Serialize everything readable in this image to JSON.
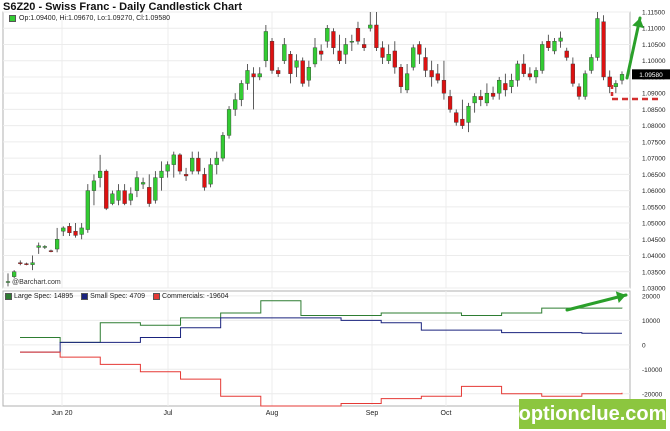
{
  "header": {
    "title": "S6Z20 - Swiss Franc - Daily Candlestick Chart",
    "ohlc_summary": "Op:1.09400, Hi:1.09670, Lo:1.09270, Cl:1.09580"
  },
  "source_label": "@Barchart.com",
  "watermark": "optionclue.com",
  "colors": {
    "up_candle": "#33cc33",
    "down_candle": "#dd1111",
    "large_spec": "#2e7d32",
    "small_spec": "#1a237e",
    "commercials": "#e53935",
    "annotation_arrow": "#2aa02a",
    "level_dash": "#d32f2f",
    "price_tag": "#000000"
  },
  "chart_data": [
    {
      "type": "candlestick",
      "title": "S6Z20 - Swiss Franc - Daily Candlestick Chart",
      "x_tick_labels": [
        "Jun 20",
        "Jul",
        "Aug",
        "Sep",
        "Oct"
      ],
      "ylim": [
        1.03,
        1.115
      ],
      "y_ticks": [
        1.115,
        1.11,
        1.105,
        1.1,
        1.095,
        1.09,
        1.085,
        1.08,
        1.075,
        1.07,
        1.065,
        1.06,
        1.055,
        1.05,
        1.045,
        1.04,
        1.035,
        1.03
      ],
      "y_tick_labels": [
        "1.11500",
        "1.11000",
        "1.10500",
        "1.10000",
        "1.09500",
        "1.09000",
        "1.08500",
        "1.08000",
        "1.07500",
        "1.07000",
        "1.06500",
        "1.06000",
        "1.05500",
        "1.05000",
        "1.04500",
        "1.04000",
        "1.03500",
        "1.03000"
      ],
      "last_price_label": "1.09580",
      "last_price": 1.0958,
      "grid": true,
      "candles": [
        {
          "o": 1.0318,
          "h": 1.0345,
          "l": 1.0305,
          "c": 1.032
        },
        {
          "o": 1.0335,
          "h": 1.0355,
          "l": 1.033,
          "c": 1.035
        },
        {
          "o": 1.0378,
          "h": 1.0385,
          "l": 1.037,
          "c": 1.0376
        },
        {
          "o": 1.0375,
          "h": 1.0378,
          "l": 1.037,
          "c": 1.0372
        },
        {
          "o": 1.0372,
          "h": 1.04,
          "l": 1.0355,
          "c": 1.0378
        },
        {
          "o": 1.0425,
          "h": 1.044,
          "l": 1.0405,
          "c": 1.043
        },
        {
          "o": 1.0426,
          "h": 1.0432,
          "l": 1.042,
          "c": 1.0428
        },
        {
          "o": 1.0415,
          "h": 1.0418,
          "l": 1.041,
          "c": 1.0412
        },
        {
          "o": 1.042,
          "h": 1.0485,
          "l": 1.041,
          "c": 1.045
        },
        {
          "o": 1.0475,
          "h": 1.049,
          "l": 1.046,
          "c": 1.0485
        },
        {
          "o": 1.049,
          "h": 1.05,
          "l": 1.046,
          "c": 1.047
        },
        {
          "o": 1.0475,
          "h": 1.05,
          "l": 1.0455,
          "c": 1.0462
        },
        {
          "o": 1.0465,
          "h": 1.05,
          "l": 1.045,
          "c": 1.0485
        },
        {
          "o": 1.048,
          "h": 1.062,
          "l": 1.047,
          "c": 1.06
        },
        {
          "o": 1.06,
          "h": 1.065,
          "l": 1.0555,
          "c": 1.063
        },
        {
          "o": 1.064,
          "h": 1.071,
          "l": 1.061,
          "c": 1.066
        },
        {
          "o": 1.066,
          "h": 1.0665,
          "l": 1.054,
          "c": 1.0545
        },
        {
          "o": 1.056,
          "h": 1.06,
          "l": 1.0555,
          "c": 1.059
        },
        {
          "o": 1.057,
          "h": 1.062,
          "l": 1.0555,
          "c": 1.06
        },
        {
          "o": 1.06,
          "h": 1.062,
          "l": 1.0555,
          "c": 1.056
        },
        {
          "o": 1.057,
          "h": 1.061,
          "l": 1.0555,
          "c": 1.059
        },
        {
          "o": 1.06,
          "h": 1.066,
          "l": 1.058,
          "c": 1.064
        },
        {
          "o": 1.062,
          "h": 1.064,
          "l": 1.0605,
          "c": 1.0625
        },
        {
          "o": 1.061,
          "h": 1.065,
          "l": 1.055,
          "c": 1.056
        },
        {
          "o": 1.057,
          "h": 1.066,
          "l": 1.056,
          "c": 1.064
        },
        {
          "o": 1.064,
          "h": 1.069,
          "l": 1.06,
          "c": 1.066
        },
        {
          "o": 1.066,
          "h": 1.069,
          "l": 1.064,
          "c": 1.068
        },
        {
          "o": 1.068,
          "h": 1.072,
          "l": 1.064,
          "c": 1.071
        },
        {
          "o": 1.071,
          "h": 1.0715,
          "l": 1.065,
          "c": 1.066
        },
        {
          "o": 1.065,
          "h": 1.067,
          "l": 1.063,
          "c": 1.0645
        },
        {
          "o": 1.066,
          "h": 1.072,
          "l": 1.065,
          "c": 1.07
        },
        {
          "o": 1.07,
          "h": 1.072,
          "l": 1.065,
          "c": 1.066
        },
        {
          "o": 1.065,
          "h": 1.067,
          "l": 1.06,
          "c": 1.061
        },
        {
          "o": 1.062,
          "h": 1.07,
          "l": 1.061,
          "c": 1.068
        },
        {
          "o": 1.068,
          "h": 1.072,
          "l": 1.065,
          "c": 1.07
        },
        {
          "o": 1.07,
          "h": 1.078,
          "l": 1.069,
          "c": 1.077
        },
        {
          "o": 1.077,
          "h": 1.086,
          "l": 1.076,
          "c": 1.085
        },
        {
          "o": 1.085,
          "h": 1.09,
          "l": 1.083,
          "c": 1.088
        },
        {
          "o": 1.088,
          "h": 1.094,
          "l": 1.086,
          "c": 1.093
        },
        {
          "o": 1.093,
          "h": 1.099,
          "l": 1.091,
          "c": 1.097
        },
        {
          "o": 1.096,
          "h": 1.098,
          "l": 1.085,
          "c": 1.095
        },
        {
          "o": 1.095,
          "h": 1.098,
          "l": 1.094,
          "c": 1.096
        },
        {
          "o": 1.1,
          "h": 1.111,
          "l": 1.098,
          "c": 1.109
        },
        {
          "o": 1.106,
          "h": 1.107,
          "l": 1.096,
          "c": 1.097
        },
        {
          "o": 1.097,
          "h": 1.098,
          "l": 1.095,
          "c": 1.096
        },
        {
          "o": 1.1,
          "h": 1.107,
          "l": 1.099,
          "c": 1.105
        },
        {
          "o": 1.102,
          "h": 1.103,
          "l": 1.093,
          "c": 1.096
        },
        {
          "o": 1.098,
          "h": 1.102,
          "l": 1.095,
          "c": 1.1
        },
        {
          "o": 1.1,
          "h": 1.101,
          "l": 1.092,
          "c": 1.093
        },
        {
          "o": 1.094,
          "h": 1.1,
          "l": 1.092,
          "c": 1.098
        },
        {
          "o": 1.099,
          "h": 1.107,
          "l": 1.098,
          "c": 1.104
        },
        {
          "o": 1.103,
          "h": 1.105,
          "l": 1.1,
          "c": 1.102
        },
        {
          "o": 1.106,
          "h": 1.111,
          "l": 1.104,
          "c": 1.11
        },
        {
          "o": 1.109,
          "h": 1.11,
          "l": 1.102,
          "c": 1.104
        },
        {
          "o": 1.103,
          "h": 1.108,
          "l": 1.099,
          "c": 1.1
        },
        {
          "o": 1.102,
          "h": 1.107,
          "l": 1.099,
          "c": 1.105
        },
        {
          "o": 1.106,
          "h": 1.108,
          "l": 1.103,
          "c": 1.106
        },
        {
          "o": 1.11,
          "h": 1.112,
          "l": 1.105,
          "c": 1.106
        },
        {
          "o": 1.105,
          "h": 1.107,
          "l": 1.103,
          "c": 1.104
        },
        {
          "o": 1.11,
          "h": 1.115,
          "l": 1.109,
          "c": 1.111
        },
        {
          "o": 1.111,
          "h": 1.115,
          "l": 1.103,
          "c": 1.104
        },
        {
          "o": 1.104,
          "h": 1.106,
          "l": 1.099,
          "c": 1.101
        },
        {
          "o": 1.1,
          "h": 1.105,
          "l": 1.099,
          "c": 1.102
        },
        {
          "o": 1.103,
          "h": 1.106,
          "l": 1.096,
          "c": 1.098
        },
        {
          "o": 1.098,
          "h": 1.099,
          "l": 1.09,
          "c": 1.092
        },
        {
          "o": 1.091,
          "h": 1.099,
          "l": 1.09,
          "c": 1.096
        },
        {
          "o": 1.098,
          "h": 1.105,
          "l": 1.097,
          "c": 1.104
        },
        {
          "o": 1.105,
          "h": 1.106,
          "l": 1.099,
          "c": 1.102
        },
        {
          "o": 1.101,
          "h": 1.104,
          "l": 1.095,
          "c": 1.097
        },
        {
          "o": 1.097,
          "h": 1.1,
          "l": 1.092,
          "c": 1.095
        },
        {
          "o": 1.096,
          "h": 1.099,
          "l": 1.093,
          "c": 1.094
        },
        {
          "o": 1.094,
          "h": 1.1,
          "l": 1.088,
          "c": 1.09
        },
        {
          "o": 1.089,
          "h": 1.091,
          "l": 1.084,
          "c": 1.085
        },
        {
          "o": 1.084,
          "h": 1.085,
          "l": 1.08,
          "c": 1.081
        },
        {
          "o": 1.082,
          "h": 1.088,
          "l": 1.079,
          "c": 1.08
        },
        {
          "o": 1.081,
          "h": 1.087,
          "l": 1.078,
          "c": 1.086
        },
        {
          "o": 1.087,
          "h": 1.09,
          "l": 1.084,
          "c": 1.089
        },
        {
          "o": 1.089,
          "h": 1.091,
          "l": 1.086,
          "c": 1.088
        },
        {
          "o": 1.087,
          "h": 1.093,
          "l": 1.086,
          "c": 1.09
        },
        {
          "o": 1.09,
          "h": 1.092,
          "l": 1.088,
          "c": 1.089
        },
        {
          "o": 1.09,
          "h": 1.095,
          "l": 1.088,
          "c": 1.094
        },
        {
          "o": 1.093,
          "h": 1.096,
          "l": 1.089,
          "c": 1.091
        },
        {
          "o": 1.092,
          "h": 1.096,
          "l": 1.09,
          "c": 1.094
        },
        {
          "o": 1.094,
          "h": 1.1,
          "l": 1.092,
          "c": 1.099
        },
        {
          "o": 1.099,
          "h": 1.102,
          "l": 1.095,
          "c": 1.096
        },
        {
          "o": 1.096,
          "h": 1.098,
          "l": 1.094,
          "c": 1.095
        },
        {
          "o": 1.095,
          "h": 1.098,
          "l": 1.093,
          "c": 1.097
        },
        {
          "o": 1.097,
          "h": 1.106,
          "l": 1.096,
          "c": 1.105
        },
        {
          "o": 1.106,
          "h": 1.108,
          "l": 1.103,
          "c": 1.104
        },
        {
          "o": 1.103,
          "h": 1.107,
          "l": 1.102,
          "c": 1.106
        },
        {
          "o": 1.106,
          "h": 1.109,
          "l": 1.104,
          "c": 1.107
        },
        {
          "o": 1.103,
          "h": 1.104,
          "l": 1.1,
          "c": 1.101
        },
        {
          "o": 1.099,
          "h": 1.101,
          "l": 1.092,
          "c": 1.093
        },
        {
          "o": 1.092,
          "h": 1.093,
          "l": 1.088,
          "c": 1.089
        },
        {
          "o": 1.089,
          "h": 1.097,
          "l": 1.088,
          "c": 1.096
        },
        {
          "o": 1.097,
          "h": 1.102,
          "l": 1.096,
          "c": 1.101
        },
        {
          "o": 1.101,
          "h": 1.115,
          "l": 1.1,
          "c": 1.113
        },
        {
          "o": 1.112,
          "h": 1.114,
          "l": 1.094,
          "c": 1.095
        },
        {
          "o": 1.095,
          "h": 1.097,
          "l": 1.09,
          "c": 1.092
        },
        {
          "o": 1.092,
          "h": 1.094,
          "l": 1.09,
          "c": 1.093
        },
        {
          "o": 1.094,
          "h": 1.0967,
          "l": 1.0927,
          "c": 1.0958
        }
      ]
    },
    {
      "type": "line",
      "title": "",
      "ylim": [
        -25000,
        22000
      ],
      "y_ticks": [
        20000,
        10000,
        0,
        -10000,
        -20000
      ],
      "y_tick_labels": [
        "20000",
        "10000",
        "0",
        "-10000",
        "-20000"
      ],
      "step": true,
      "series": [
        {
          "name": "Large Spec",
          "legend": "Large Spec: 14895",
          "color_key": "large_spec",
          "values": [
            3000,
            1000,
            9000,
            8000,
            11000,
            13000,
            18000,
            12000,
            12000,
            13000,
            13000,
            12000,
            13000,
            15000,
            15000,
            14895
          ]
        },
        {
          "name": "Small Spec",
          "legend": "Small Spec: 4709",
          "color_key": "small_spec",
          "values": [
            -3000,
            1000,
            1000,
            3000,
            7000,
            11000,
            11000,
            11000,
            10000,
            9000,
            6000,
            6000,
            5000,
            5000,
            4709,
            4709
          ]
        },
        {
          "name": "Commercials",
          "legend": "Commercials: -19604",
          "color_key": "commercials",
          "values": [
            -3000,
            -5000,
            -8000,
            -11000,
            -14000,
            -21000,
            -25000,
            -25000,
            -24000,
            -22000,
            -21000,
            -17000,
            -20000,
            -21000,
            -20000,
            -19604
          ]
        }
      ]
    }
  ]
}
